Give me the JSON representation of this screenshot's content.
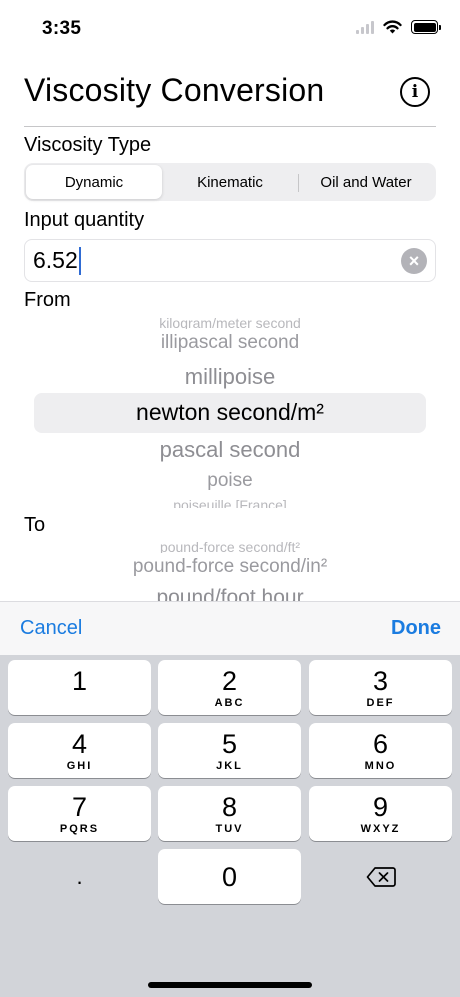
{
  "status": {
    "time": "3:35"
  },
  "header": {
    "title": "Viscosity Conversion",
    "info_icon": "i"
  },
  "viscosity_type": {
    "label": "Viscosity Type",
    "segments": [
      "Dynamic",
      "Kinematic",
      "Oil and Water"
    ],
    "selected": "Dynamic"
  },
  "input": {
    "label": "Input quantity",
    "value": "6.52",
    "clear_icon": "×"
  },
  "from": {
    "label": "From",
    "items": [
      "kilogram/meter second",
      "illipascal second",
      "millipoise",
      "newton second/m²",
      "pascal second",
      "poise",
      "poiseuille [France]"
    ],
    "selected": "newton second/m²"
  },
  "to": {
    "label": "To",
    "items": [
      "pound-force second/ft²",
      "pound-force second/in²",
      "pound/foot hour"
    ]
  },
  "accessory": {
    "cancel": "Cancel",
    "done": "Done"
  },
  "keypad": {
    "keys": [
      {
        "num": "1",
        "letters": ""
      },
      {
        "num": "2",
        "letters": "ABC"
      },
      {
        "num": "3",
        "letters": "DEF"
      },
      {
        "num": "4",
        "letters": "GHI"
      },
      {
        "num": "5",
        "letters": "JKL"
      },
      {
        "num": "6",
        "letters": "MNO"
      },
      {
        "num": "7",
        "letters": "PQRS"
      },
      {
        "num": "8",
        "letters": "TUV"
      },
      {
        "num": "9",
        "letters": "WXYZ"
      },
      {
        "num": "0",
        "letters": ""
      }
    ],
    "decimal": "."
  },
  "colors": {
    "accent": "#1b7ce0",
    "keyboard_bg": "#d2d4d9"
  }
}
